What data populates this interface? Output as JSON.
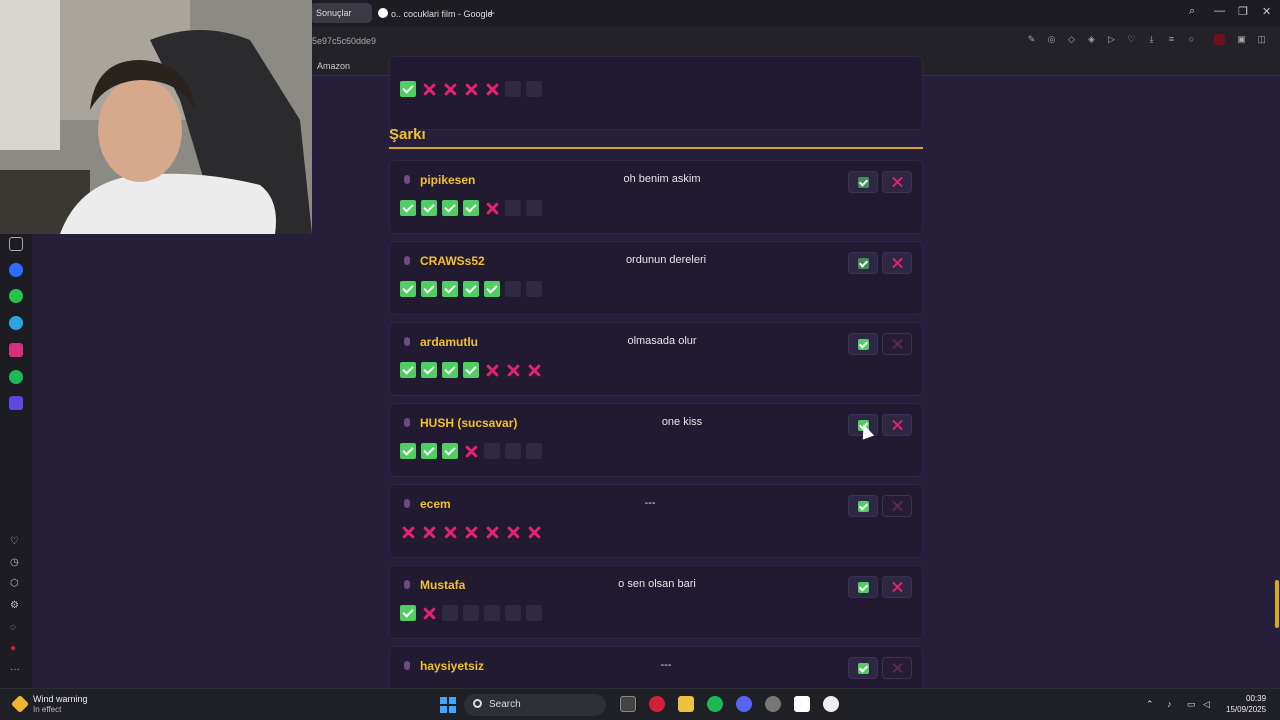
{
  "browser": {
    "tabs": [
      {
        "label": "Sonuçlar"
      },
      {
        "label": "o.. cocuklari film - Google"
      }
    ],
    "url": "5e97c5c60dde9",
    "bookmarks": [
      {
        "label": "Amazon"
      }
    ]
  },
  "section": {
    "title": "Şarkı"
  },
  "entries": [
    {
      "name": "",
      "answer": "",
      "votes": [
        "ok",
        "no",
        "no",
        "no",
        "no",
        "empty",
        "empty"
      ],
      "ok_dim": false,
      "no_dim": false
    },
    {
      "name": "pipikesen",
      "answer": "oh benim askim",
      "votes": [
        "ok",
        "ok",
        "ok",
        "ok",
        "no",
        "empty",
        "empty"
      ],
      "ok_dim": true,
      "no_dim": false
    },
    {
      "name": "CRAWSs52",
      "answer": "ordunun dereleri",
      "votes": [
        "ok",
        "ok",
        "ok",
        "ok",
        "ok",
        "empty",
        "empty"
      ],
      "ok_dim": true,
      "no_dim": false
    },
    {
      "name": "ardamutlu",
      "answer": "olmasada olur",
      "votes": [
        "ok",
        "ok",
        "ok",
        "ok",
        "no",
        "no",
        "no"
      ],
      "ok_dim": false,
      "no_dim": true
    },
    {
      "name": "HUSH (sucsavar)",
      "answer": "one kiss",
      "votes": [
        "ok",
        "ok",
        "ok",
        "no",
        "empty",
        "empty",
        "empty"
      ],
      "ok_dim": false,
      "no_dim": false
    },
    {
      "name": "ecem",
      "answer": "---",
      "votes": [
        "no",
        "no",
        "no",
        "no",
        "no",
        "no",
        "no"
      ],
      "ok_dim": false,
      "no_dim": true
    },
    {
      "name": "Mustafa",
      "answer": "o sen olsan bari",
      "votes": [
        "ok",
        "no",
        "empty",
        "empty",
        "empty",
        "empty",
        "empty"
      ],
      "ok_dim": false,
      "no_dim": false
    },
    {
      "name": "haysiyetsiz",
      "answer": "---",
      "votes": [],
      "ok_dim": false,
      "no_dim": true
    }
  ],
  "taskbar": {
    "weather_title": "Wind warning",
    "weather_sub": "In effect",
    "search_label": "Search",
    "time": "00:39",
    "date": "15/09/2025"
  },
  "colors": {
    "accent": "#f2c12e",
    "ok": "#4fcf62",
    "no": "#e0246e",
    "bg": "#261e3a"
  }
}
